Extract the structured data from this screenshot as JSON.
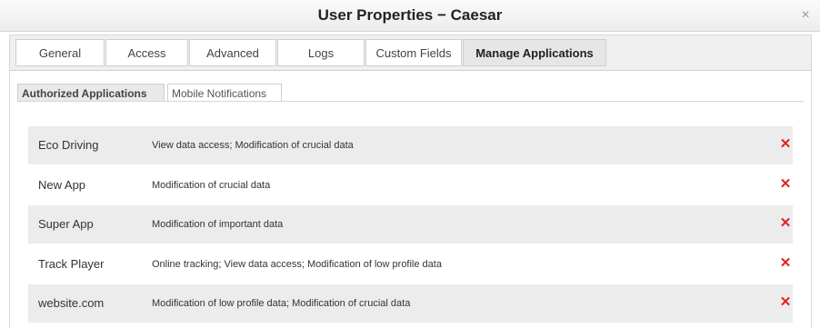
{
  "window": {
    "title": "User Properties − Caesar",
    "close_icon": "×"
  },
  "tabs": [
    {
      "label": "General"
    },
    {
      "label": "Access"
    },
    {
      "label": "Advanced"
    },
    {
      "label": "Logs"
    },
    {
      "label": "Custom Fields"
    },
    {
      "label": "Manage Applications",
      "active": true
    }
  ],
  "subtabs": [
    {
      "label": "Authorized Applications",
      "active": true
    },
    {
      "label": "Mobile Notifications"
    }
  ],
  "applications": [
    {
      "name": "Eco Driving",
      "permissions": "View data access; Modification of crucial data",
      "remove": "✕"
    },
    {
      "name": "New App",
      "permissions": "Modification of crucial data",
      "remove": "✕"
    },
    {
      "name": "Super App",
      "permissions": "Modification of important data",
      "remove": "✕"
    },
    {
      "name": "Track Player",
      "permissions": "Online tracking; View data access; Modification of low profile data",
      "remove": "✕"
    },
    {
      "name": "website.com",
      "permissions": "Modification of low profile data; Modification of crucial data",
      "remove": "✕"
    }
  ],
  "colors": {
    "remove_icon": "#e32020",
    "row_shade": "#ececec",
    "active_tab": "#e6e6e6"
  }
}
